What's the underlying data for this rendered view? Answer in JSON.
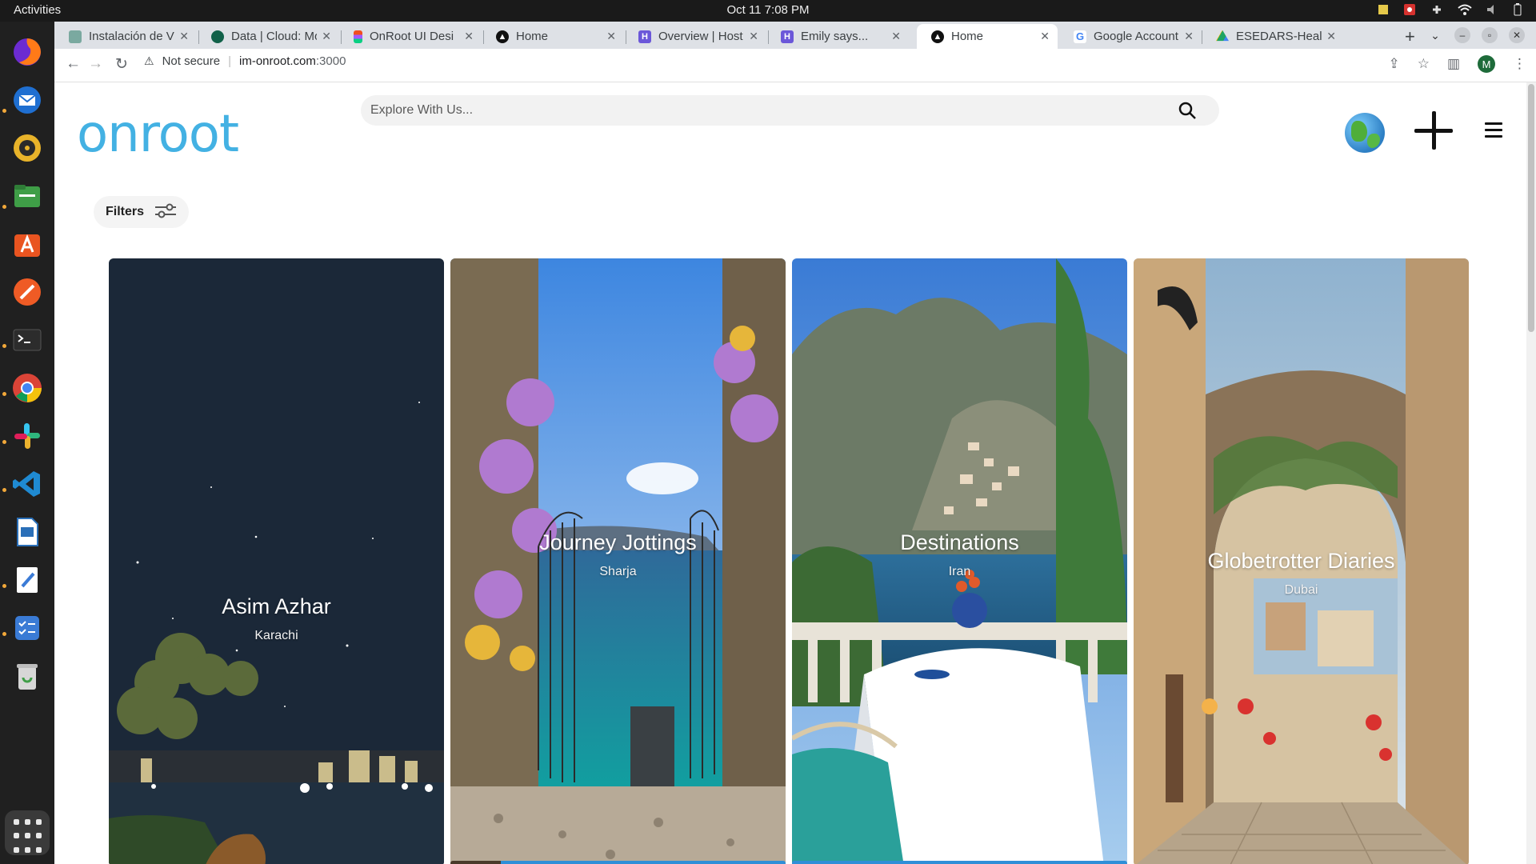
{
  "system": {
    "activities": "Activities",
    "clock": "Oct 11  7:08 PM"
  },
  "tabs": [
    {
      "title": "Instalación de V",
      "favicon_color": "#7aa9a0"
    },
    {
      "title": "Data | Cloud: Mo",
      "favicon_color": "#116149"
    },
    {
      "title": "OnRoot UI Desi",
      "favicon_color": "#f24e1e"
    },
    {
      "title": "Home",
      "favicon_color": "#111111"
    },
    {
      "title": "Overview | Host",
      "favicon_color": "#6b57d9"
    },
    {
      "title": "Emily says...",
      "favicon_color": "#6b57d9"
    },
    {
      "title": "Home",
      "favicon_color": "#111111",
      "active": true
    },
    {
      "title": "Google Account",
      "favicon_color": "#4285f4"
    },
    {
      "title": "ESEDARS-Healt",
      "favicon_color": "#1fa463"
    }
  ],
  "addressbar": {
    "security": "Not secure",
    "host": "im-onroot.com",
    "port": ":3000",
    "profile_initial": "M"
  },
  "header": {
    "logo": "onroot",
    "search_placeholder": "Explore With Us..."
  },
  "filters": {
    "label": "Filters"
  },
  "cards": [
    {
      "title": "Asim Azhar",
      "subtitle": "Karachi"
    },
    {
      "title": "Journey Jottings",
      "subtitle": "Sharja"
    },
    {
      "title": "Destinations",
      "subtitle": "Iran"
    },
    {
      "title": "Globetrotter Diaries",
      "subtitle": "Dubai"
    }
  ],
  "colors": {
    "brand": "#43b1e3",
    "night_sky": "#1b2838",
    "topbar": "#1a1a1a",
    "dock": "#202020"
  }
}
